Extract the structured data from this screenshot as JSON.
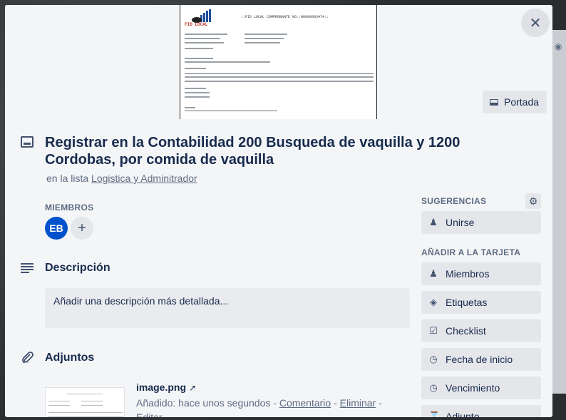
{
  "cover": {
    "button_label": "Portada",
    "doc_header": "::FID LOCAL COMPROBANTE NO.:N0000003474::",
    "doc_logo": "FID LOCAL"
  },
  "card": {
    "title": "Registrar en la Contabilidad 200 Busqueda de vaquilla y 1200 Cordobas, por comida de vaquilla",
    "in_list_prefix": "en la lista",
    "list_name": "Logistica y Adminitrador"
  },
  "members": {
    "label": "MIEMBROS",
    "avatar_initials": "EB",
    "add_symbol": "+"
  },
  "description": {
    "title": "Descripción",
    "placeholder": "Añadir una descripción más detallada..."
  },
  "attachments": {
    "title": "Adjuntos",
    "file_name": "image.png",
    "open_symbol": "↗",
    "added_prefix": "Añadido: hace unos segundos -",
    "comment_link": "Comentario",
    "separator": "-",
    "delete_link": "Eliminar",
    "separator2": "-",
    "edit_link": "Editar"
  },
  "sidebar": {
    "suggestions_label": "SUGERENCIAS",
    "join_label": "Unirse",
    "add_to_card_label": "AÑADIR A LA TARJETA",
    "buttons": [
      {
        "label": "Miembros",
        "icon": "person-icon"
      },
      {
        "label": "Etiquetas",
        "icon": "tag-icon"
      },
      {
        "label": "Checklist",
        "icon": "checkbox-icon"
      },
      {
        "label": "Fecha de inicio",
        "icon": "clock-icon"
      },
      {
        "label": "Vencimiento",
        "icon": "clock-icon"
      },
      {
        "label": "Adjunto",
        "icon": "paperclip-icon"
      }
    ]
  },
  "close_symbol": "✕"
}
